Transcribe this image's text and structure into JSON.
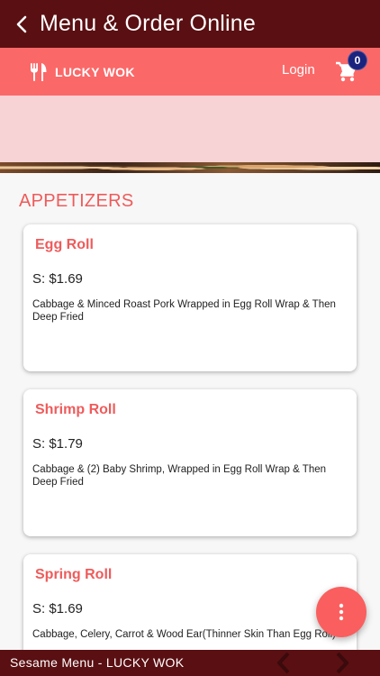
{
  "appbar": {
    "title": "Menu & Order Online"
  },
  "header": {
    "brand_name": "LUCKY WOK",
    "login_label": "Login",
    "cart_count": "0"
  },
  "menu": {
    "section_title": "APPETIZERS",
    "items": [
      {
        "name": "Egg Roll",
        "price": "S: $1.69",
        "description": "Cabbage & Minced Roast Pork Wrapped in Egg Roll Wrap & Then Deep Fried"
      },
      {
        "name": "Shrimp Roll",
        "price": "S: $1.79",
        "description": "Cabbage & (2) Baby Shrimp, Wrapped in Egg Roll Wrap & Then Deep Fried"
      },
      {
        "name": "Spring Roll",
        "price": "S: $1.69",
        "description": "Cabbage, Celery, Carrot & Wood Ear(Thinner Skin Than Egg Roll)"
      }
    ]
  },
  "footer": {
    "label": "Sesame Menu - LUCKY WOK"
  },
  "icons": {
    "back": "chevron-left-icon",
    "brand": "fork-knife-icon",
    "cart": "cart-icon",
    "fab": "more-vertical-icon",
    "prev": "chevron-left-icon",
    "next": "chevron-right-icon"
  },
  "colors": {
    "appbar": "#5a0f12",
    "header": "#fb6868",
    "accent": "#ef5b5b",
    "badge": "#1a237e",
    "banner": "#f7d3d6"
  }
}
